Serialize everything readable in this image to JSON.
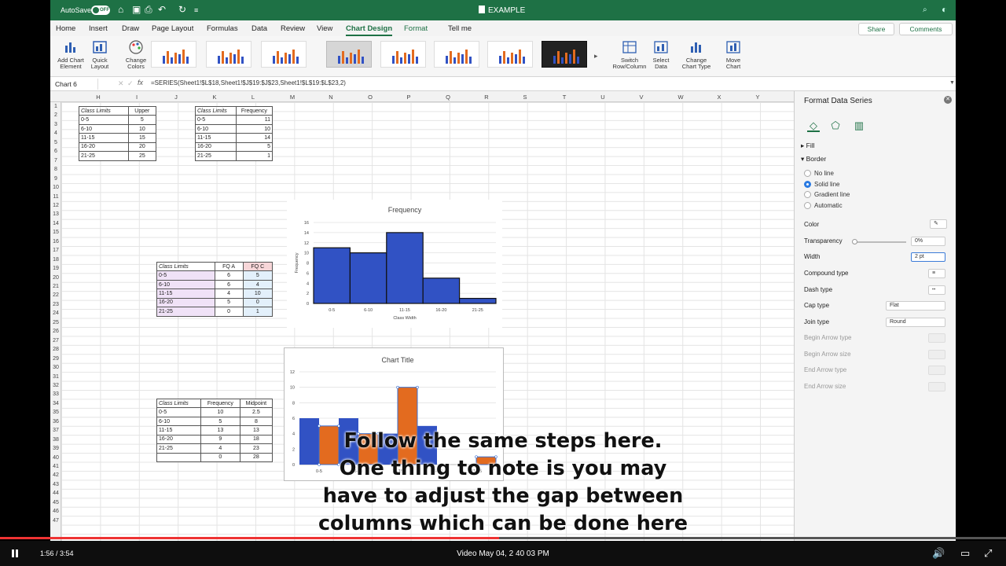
{
  "titlebar": {
    "autosave_label": "AutoSave",
    "autosave_state": "OFF",
    "doc_title": "EXAMPLE"
  },
  "tabs": [
    {
      "label": "Home",
      "active": false
    },
    {
      "label": "Insert",
      "active": false
    },
    {
      "label": "Draw",
      "active": false
    },
    {
      "label": "Page Layout",
      "active": false
    },
    {
      "label": "Formulas",
      "active": false
    },
    {
      "label": "Data",
      "active": false
    },
    {
      "label": "Review",
      "active": false
    },
    {
      "label": "View",
      "active": false
    },
    {
      "label": "Chart Design",
      "active": true
    },
    {
      "label": "Format",
      "active": false
    },
    {
      "label": "Tell me",
      "active": false
    }
  ],
  "share_label": "Share",
  "comments_label": "Comments",
  "ribbon": {
    "add_chart_element": "Add Chart Element",
    "quick_layout": "Quick Layout",
    "change_colors": "Change Colors",
    "switch_row_column": "Switch Row/Column",
    "select_data": "Select Data",
    "change_chart_type": "Change Chart Type",
    "move_chart": "Move Chart"
  },
  "namebox": "Chart 6",
  "formula": "=SERIES(Sheet1!$L$18,Sheet1!$J$19:$J$23,Sheet1!$L$19:$L$23,2)",
  "columns": [
    "H",
    "I",
    "J",
    "K",
    "L",
    "M",
    "N",
    "O",
    "P",
    "Q",
    "R",
    "S",
    "T",
    "U",
    "V",
    "W",
    "X",
    "Y"
  ],
  "rows": [
    "1",
    "2",
    "3",
    "4",
    "5",
    "6",
    "7",
    "8",
    "9",
    "10",
    "11",
    "12",
    "13",
    "14",
    "15",
    "16",
    "17",
    "18",
    "19",
    "20",
    "21",
    "22",
    "23",
    "24",
    "25",
    "26",
    "27",
    "28",
    "29",
    "30",
    "31",
    "32",
    "33",
    "34",
    "35",
    "36",
    "37",
    "38",
    "39",
    "40",
    "41",
    "42",
    "43",
    "44",
    "45",
    "46",
    "47"
  ],
  "table_upper": {
    "headers": [
      "Class Limits",
      "Upper"
    ],
    "rows": [
      [
        "0-5",
        "5"
      ],
      [
        "6-10",
        "10"
      ],
      [
        "11-15",
        "15"
      ],
      [
        "16-20",
        "20"
      ],
      [
        "21-25",
        "25"
      ]
    ]
  },
  "table_freq": {
    "headers": [
      "Class Limits",
      "Frequency"
    ],
    "rows": [
      [
        "0-5",
        "11"
      ],
      [
        "6-10",
        "10"
      ],
      [
        "11-15",
        "14"
      ],
      [
        "16-20",
        "5"
      ],
      [
        "21-25",
        "1"
      ]
    ]
  },
  "table_fq": {
    "headers": [
      "Class Limits",
      "FQ A",
      "FQ C"
    ],
    "rows": [
      [
        "0-5",
        "6",
        "5"
      ],
      [
        "6-10",
        "6",
        "4"
      ],
      [
        "11-15",
        "4",
        "10"
      ],
      [
        "16-20",
        "5",
        "0"
      ],
      [
        "21-25",
        "0",
        "1"
      ]
    ]
  },
  "table_mid": {
    "headers": [
      "Class Limits",
      "Frequency",
      "Midpoint"
    ],
    "rows": [
      [
        "0-5",
        "10",
        "2.5"
      ],
      [
        "6-10",
        "5",
        "8"
      ],
      [
        "11-15",
        "13",
        "13"
      ],
      [
        "16-20",
        "9",
        "18"
      ],
      [
        "21-25",
        "4",
        "23"
      ],
      [
        "",
        "0",
        "28"
      ]
    ]
  },
  "chart_data": [
    {
      "type": "bar",
      "title": "Frequency",
      "xlabel": "Class Width",
      "ylabel": "Frequency",
      "categories": [
        "0-5",
        "6-10",
        "11-15",
        "16-20",
        "21-25"
      ],
      "values": [
        11,
        10,
        14,
        5,
        1
      ],
      "ylim": [
        0,
        16
      ],
      "yticks": [
        "0",
        "2",
        "4",
        "6",
        "8",
        "10",
        "12",
        "14",
        "16"
      ],
      "grid": true,
      "color": "#3152c4"
    },
    {
      "type": "bar",
      "title": "Chart Title",
      "xlabel": "",
      "ylabel": "",
      "categories": [
        "0-5",
        "6-10",
        "11-15",
        "16-20",
        "21-25"
      ],
      "series": [
        {
          "values": [
            6,
            6,
            4,
            5,
            0
          ],
          "color": "#3152c4"
        },
        {
          "values": [
            5,
            4,
            10,
            0,
            1
          ],
          "color": "#e36b1f"
        }
      ],
      "ylim": [
        0,
        12
      ],
      "yticks": [
        "0",
        "2",
        "4",
        "6",
        "8",
        "10",
        "12"
      ],
      "grid": true
    }
  ],
  "pane": {
    "title": "Format Data Series",
    "fill_label": "Fill",
    "border_label": "Border",
    "radio_options": [
      {
        "label": "No line",
        "selected": false
      },
      {
        "label": "Solid line",
        "selected": true
      },
      {
        "label": "Gradient line",
        "selected": false
      },
      {
        "label": "Automatic",
        "selected": false
      }
    ],
    "color_label": "Color",
    "transparency_label": "Transparency",
    "transparency_value": "0%",
    "width_label": "Width",
    "width_value": "2 pt",
    "compound_label": "Compound type",
    "dash_label": "Dash type",
    "cap_label": "Cap type",
    "cap_value": "Flat",
    "join_label": "Join type",
    "join_value": "Round",
    "begin_arrow_type": "Begin Arrow type",
    "begin_arrow_size": "Begin Arrow size",
    "end_arrow_type": "End Arrow type",
    "end_arrow_size": "End Arrow size"
  },
  "overlay_lines": [
    "Follow the same steps here.",
    "One thing to note is you may",
    "have to adjust the gap between",
    "columns which can be done here"
  ],
  "video": {
    "time": "1:56 / 3:54",
    "title": "Video May 04, 2 40 03 PM",
    "progress": 0.496
  }
}
